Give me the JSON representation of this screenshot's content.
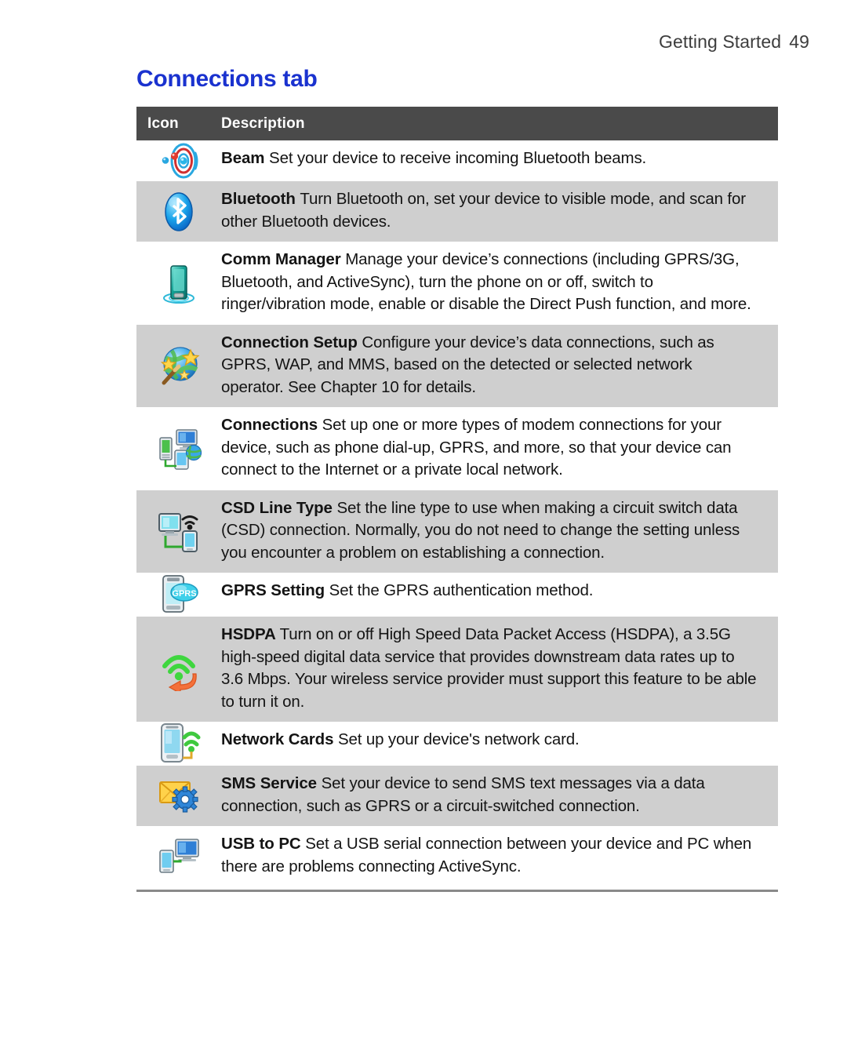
{
  "header": {
    "chapter": "Getting Started",
    "page_number": "49"
  },
  "section": {
    "title": "Connections tab",
    "title_color": "#1a32cf"
  },
  "table": {
    "header_bg": "#4a4a4a",
    "alt_row_bg": "#cfcfcf",
    "columns": [
      "Icon",
      "Description"
    ],
    "rows": [
      {
        "icon": "beam-icon",
        "term": "Beam",
        "text": "Set your device to receive incoming Bluetooth beams.",
        "shaded": false
      },
      {
        "icon": "bluetooth-icon",
        "term": "Bluetooth",
        "text": "Turn Bluetooth on, set your device to visible mode, and scan for other Bluetooth devices.",
        "shaded": true
      },
      {
        "icon": "comm-manager-icon",
        "term": "Comm Manager",
        "text": "Manage your device’s connections (including GPRS/3G, Bluetooth, and ActiveSync), turn the phone on or off, switch to ringer/vibration mode, enable or disable the Direct Push function, and more.",
        "shaded": false
      },
      {
        "icon": "connection-setup-icon",
        "term": "Connection Setup",
        "text": "Configure your device’s data connections, such as GPRS, WAP, and MMS, based on the detected or selected network operator. See Chapter 10 for details.",
        "shaded": true
      },
      {
        "icon": "connections-icon",
        "term": "Connections",
        "text": "Set up one or more types of modem connections for your device, such as phone dial-up, GPRS, and more, so that your device can connect to the Internet or a private local network.",
        "shaded": false
      },
      {
        "icon": "csd-line-type-icon",
        "term": "CSD Line Type",
        "text": "Set the line type to use when making a circuit switch data (CSD) connection. Normally, you do not need to change the setting unless you encounter a problem on establishing a connection.",
        "shaded": true
      },
      {
        "icon": "gprs-setting-icon",
        "term": "GPRS Setting",
        "text": "Set the GPRS authentication method.",
        "shaded": false
      },
      {
        "icon": "hsdpa-icon",
        "term": "HSDPA",
        "text": "Turn on or off High Speed Data Packet Access (HSDPA), a 3.5G high-speed digital data service that provides downstream data rates up to 3.6 Mbps. Your wireless service provider must support this feature to be able to turn it on.",
        "shaded": true
      },
      {
        "icon": "network-cards-icon",
        "term": "Network Cards",
        "text": "Set up your device's network card.",
        "shaded": false
      },
      {
        "icon": "sms-service-icon",
        "term": "SMS Service",
        "text": "Set your device to send SMS text messages via a data connection, such as GPRS or a circuit-switched connection.",
        "shaded": true
      },
      {
        "icon": "usb-to-pc-icon",
        "term": "USB to PC",
        "text": "Set a USB serial connection between your device and PC when there are problems connecting ActiveSync.",
        "shaded": false
      }
    ]
  }
}
